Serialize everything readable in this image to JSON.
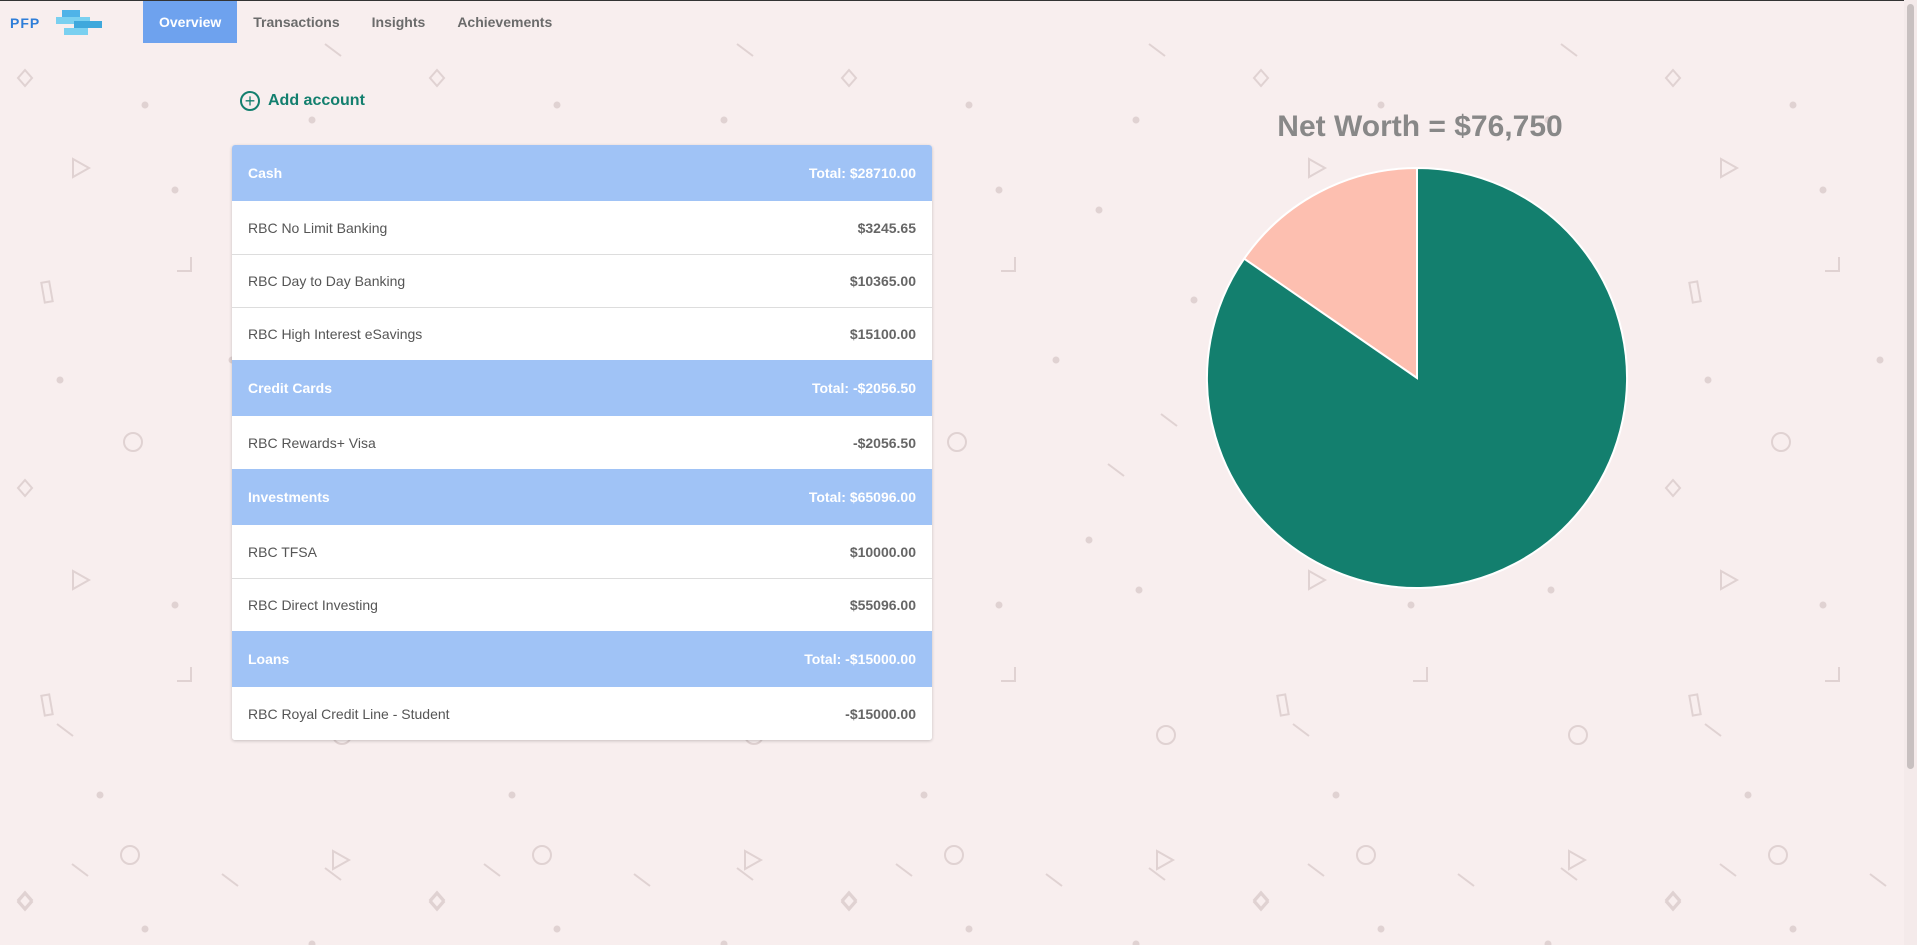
{
  "app": {
    "logo_text": "PFP"
  },
  "nav": {
    "tabs": [
      {
        "label": "Overview",
        "active": true
      },
      {
        "label": "Transactions",
        "active": false
      },
      {
        "label": "Insights",
        "active": false
      },
      {
        "label": "Achievements",
        "active": false
      }
    ]
  },
  "actions": {
    "add_account": "Add account"
  },
  "accounts": {
    "groups": [
      {
        "name": "Cash",
        "total": "Total: $28710.00",
        "items": [
          {
            "name": "RBC No Limit Banking",
            "amount": "$3245.65"
          },
          {
            "name": "RBC Day to Day Banking",
            "amount": "$10365.00"
          },
          {
            "name": "RBC High Interest eSavings",
            "amount": "$15100.00"
          }
        ]
      },
      {
        "name": "Credit Cards",
        "total": "Total: -$2056.50",
        "items": [
          {
            "name": "RBC Rewards+ Visa",
            "amount": "-$2056.50"
          }
        ]
      },
      {
        "name": "Investments",
        "total": "Total: $65096.00",
        "items": [
          {
            "name": "RBC TFSA",
            "amount": "$10000.00"
          },
          {
            "name": "RBC Direct Investing",
            "amount": "$55096.00"
          }
        ]
      },
      {
        "name": "Loans",
        "total": "Total: -$15000.00",
        "items": [
          {
            "name": "RBC Royal Credit Line - Student",
            "amount": "-$15000.00"
          }
        ]
      }
    ]
  },
  "chart_data": {
    "type": "pie",
    "title": "Net Worth = $76,750",
    "slices": [
      {
        "value": 17056.5,
        "color": "#fdbfb0"
      },
      {
        "value": 93806.0,
        "color": "#137f6e"
      }
    ]
  },
  "colors": {
    "accent": "#6ea2ee",
    "header": "#a0c3f6",
    "teal": "#137f6e",
    "peach": "#fdbfb0",
    "background": "#f8eeee"
  }
}
